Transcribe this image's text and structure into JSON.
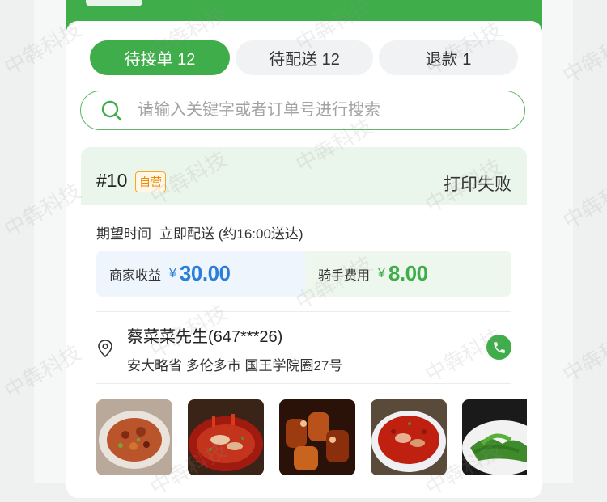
{
  "tabs": [
    {
      "label": "待接单 12",
      "active": true
    },
    {
      "label": "待配送 12",
      "active": false
    },
    {
      "label": "退款 1",
      "active": false
    }
  ],
  "search": {
    "placeholder": "请输入关键字或者订单号进行搜索"
  },
  "order": {
    "number": "#10",
    "badge": "自营",
    "print_status": "打印失败",
    "expect_label": "期望时间",
    "expect_value": "立即配送 (约16:00送达)",
    "merchant_income_label": "商家收益",
    "merchant_income_currency": "¥",
    "merchant_income_amount": "30.00",
    "rider_fee_label": "骑手费用",
    "rider_fee_currency": "¥",
    "rider_fee_amount": "8.00",
    "customer_name": "蔡菜菜先生(647***26)",
    "customer_address": "安大略省 多伦多市 国王学院圈27号"
  },
  "watermark": "中犇科技",
  "colors": {
    "primary": "#3fad4a",
    "income_blue": "#2b7fd8",
    "badge_orange": "#f08a00"
  }
}
